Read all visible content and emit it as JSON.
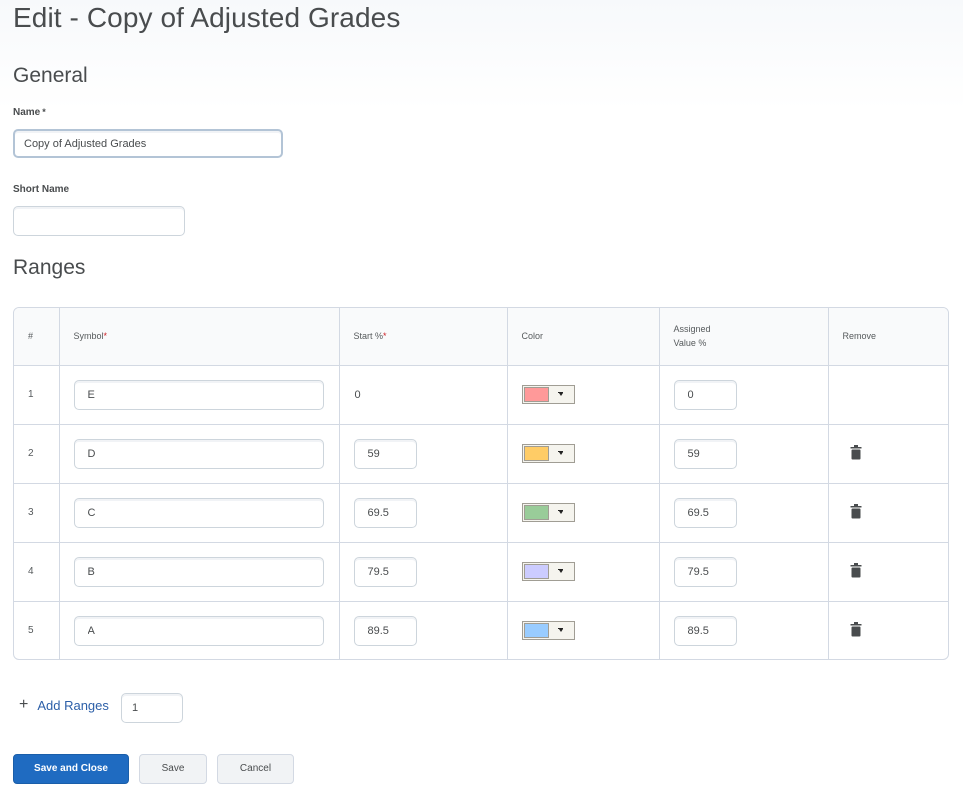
{
  "page": {
    "title": "Edit - Copy of Adjusted Grades"
  },
  "general": {
    "heading": "General",
    "name_label": "Name",
    "name_required_marker": "*",
    "name_value": "Copy of Adjusted Grades",
    "short_name_label": "Short Name",
    "short_name_value": ""
  },
  "ranges": {
    "heading": "Ranges",
    "columns": {
      "index": "#",
      "symbol": "Symbol",
      "start": "Start %",
      "color": "Color",
      "assigned_line1": "Assigned",
      "assigned_line2": "Value %",
      "remove": "Remove",
      "required_marker": "*"
    },
    "rows": [
      {
        "index": "1",
        "symbol": "E",
        "start": "0",
        "start_editable": false,
        "color": "#ff9999",
        "assigned": "0",
        "removable": false
      },
      {
        "index": "2",
        "symbol": "D",
        "start": "59",
        "start_editable": true,
        "color": "#ffcc66",
        "assigned": "59",
        "removable": true
      },
      {
        "index": "3",
        "symbol": "C",
        "start": "69.5",
        "start_editable": true,
        "color": "#99cc99",
        "assigned": "69.5",
        "removable": true
      },
      {
        "index": "4",
        "symbol": "B",
        "start": "79.5",
        "start_editable": true,
        "color": "#ccccff",
        "assigned": "79.5",
        "removable": true
      },
      {
        "index": "5",
        "symbol": "A",
        "start": "89.5",
        "start_editable": true,
        "color": "#99ccff",
        "assigned": "89.5",
        "removable": true
      }
    ],
    "add_label": "Add Ranges",
    "add_count": "1"
  },
  "actions": {
    "save_and_close": "Save and Close",
    "save": "Save",
    "cancel": "Cancel"
  },
  "icons": {
    "add": "plus-icon",
    "remove": "trash-icon",
    "color_dropdown": "caret-down-icon"
  },
  "colors": {
    "primary": "#1f6bc1",
    "link": "#2c5fa8",
    "required": "#cd2026"
  }
}
